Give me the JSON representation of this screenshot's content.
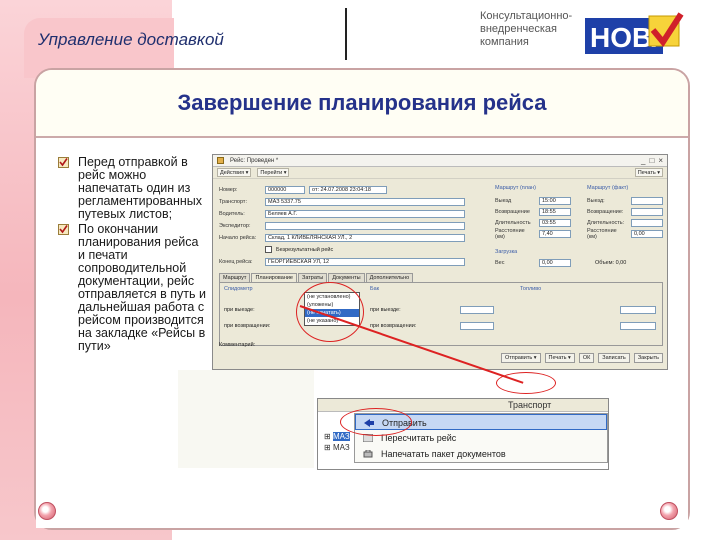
{
  "header": {
    "brand_title": "Управление доставкой",
    "company_text": "Консультационно-внедренческая компания",
    "logo_text": "НОВА",
    "colors": {
      "logo_blue": "#1e40a8",
      "logo_red": "#d0202a",
      "pink": "#f5b6bc"
    }
  },
  "slide": {
    "title": "Завершение планирования рейса"
  },
  "bullets": [
    "Перед отправкой в рейс можно напечатать один из регламентированных путевых листов;",
    "По окончании планирования рейса и печати сопроводительной документации, рейс отправляется в путь и дальнейшая работа с рейсом производится на закладке «Рейсы в пути»"
  ],
  "form": {
    "window_title": "Рейс: Проведен *",
    "toolbar": [
      "Действия ▾",
      "Перейти ▾",
      "Печать ▾"
    ],
    "fields": [
      {
        "label": "Номер:",
        "value": "000000",
        "extra": "от: 24.07.2008 23:04:18"
      },
      {
        "label": "Транспорт:",
        "value": "МАЗ 5337.75"
      },
      {
        "label": "Водитель:",
        "value": "Беляев А.Г."
      },
      {
        "label": "Экспедитор:",
        "value": ""
      },
      {
        "label": "Начало рейса:",
        "value": "Склад, 1 КЛИВЕЛЯНСКАЯ УЛ., 2"
      },
      {
        "label": "Конец рейса:",
        "value": "ГЕОРГИЕВСКАЯ УЛ, 12"
      }
    ],
    "checkbox_label": "Безрезультатный рейс",
    "group_plan": "Маршрут (план)",
    "group_fact": "Маршрут (факт)",
    "group_load": "Загрузка",
    "plan_rows": [
      {
        "label": "Выезд",
        "value": "15:00"
      },
      {
        "label": "Возвращение",
        "value": "18:55"
      },
      {
        "label": "Длительность",
        "value": "03:55"
      },
      {
        "label": "Расстояние (км)",
        "value": "7,40"
      }
    ],
    "fact_rows": [
      {
        "label": "Выезд:",
        "value": ""
      },
      {
        "label": "Возвращение:",
        "value": ""
      },
      {
        "label": "Длительность:",
        "value": ""
      },
      {
        "label": "Расстояние (км)",
        "value": "0,00"
      }
    ],
    "load_row": {
      "label": "Вес",
      "value": "0,00",
      "extra": "Объем: 0,00"
    },
    "tabs": [
      "Маршрут",
      "Планирование",
      "Затраты",
      "Документы",
      "Дополнительно"
    ],
    "panel_groups": [
      "Спидометр",
      "Бак",
      "Топливо"
    ],
    "panel_rows": [
      "при выезде:",
      "при возвращении:"
    ],
    "dropdown": [
      "(не установлено)",
      "(уложены)",
      "(не печатать)",
      "(не указано)"
    ],
    "comment_label": "Комментарий:",
    "bottom_buttons": [
      "Отправить ▾",
      "Печать ▾",
      "ОК",
      "Записать",
      "Закрыть"
    ]
  },
  "menu": {
    "header_label": "Транспорт",
    "tree_items": [
      "МАЗ",
      "МАЗ"
    ],
    "items": [
      "Отправить",
      "Пересчитать рейс",
      "Напечатать пакет документов"
    ]
  }
}
